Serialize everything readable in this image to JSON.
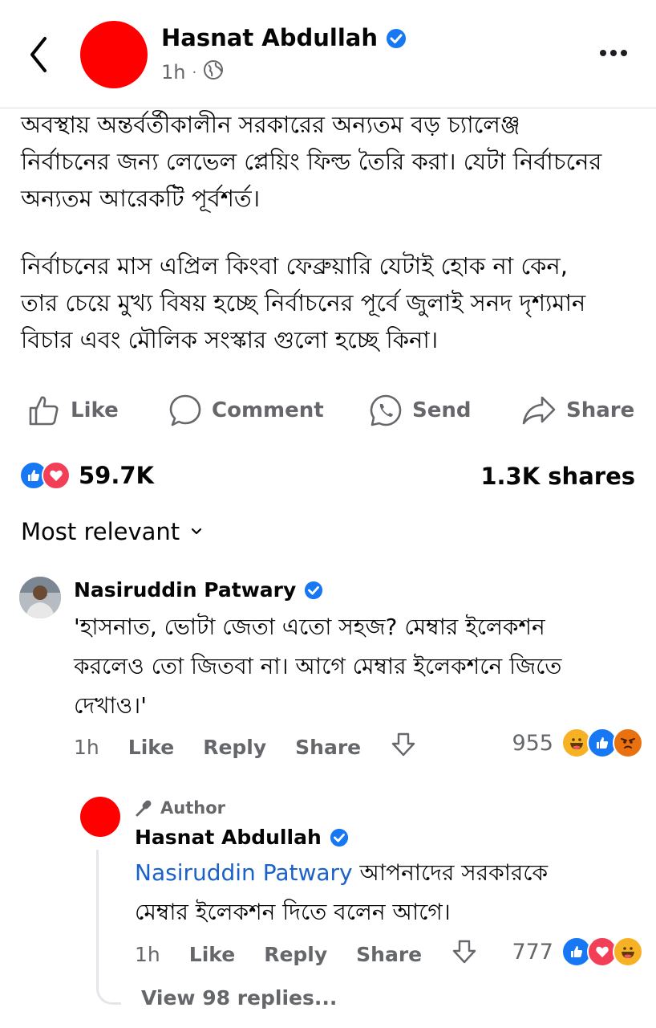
{
  "header": {
    "name": "Hasnat Abdullah",
    "time": "1h",
    "separator": "·"
  },
  "post": {
    "paragraph1": [
      "অবস্থায় অন্তর্বর্তীকালীন সরকারের অন্যতম বড় চ্যালেঞ্জ",
      "নির্বাচনের জন্য লেভেল প্লেয়িং ফিল্ড তৈরি করা। যেটা নির্বাচনের",
      "অন্যতম আরেকটি পূর্বশর্ত।"
    ],
    "paragraph2": [
      "নির্বাচনের মাস এপ্রিল কিংবা ফেব্রুয়ারি যেটাই হোক না কেন,",
      "তার চেয়ে মুখ্য বিষয় হচ্ছে নির্বাচনের পূর্বে জুলাই সনদ দৃশ্যমান",
      "বিচার এবং মৌলিক সংস্কার গুলো হচ্ছে কিনা।"
    ]
  },
  "actions": {
    "like": "Like",
    "comment": "Comment",
    "send": "Send",
    "share": "Share"
  },
  "stats": {
    "reactions_count": "59.7K",
    "shares": "1.3K shares"
  },
  "sort": {
    "label": "Most relevant"
  },
  "comment1": {
    "name": "Nasiruddin Patwary",
    "lines": [
      "'হাসনাত, ভোটা জেতা এতো সহজ? মেম্বার ইলেকশন",
      "করলেও তো জিতবা না। আগে মেম্বার ইলেকশনে জিতে",
      "দেখাও।'"
    ],
    "time": "1h",
    "like": "Like",
    "reply": "Reply",
    "share": "Share",
    "reaction_count": "955"
  },
  "reply1": {
    "author_label": "Author",
    "name": "Hasnat Abdullah",
    "mention": "Nasiruddin Patwary",
    "line1_rest": " আপনাদের সরকারকে",
    "line2": "মেম্বার ইলেকশন দিতে বলেন আগে।",
    "time": "1h",
    "like": "Like",
    "reply": "Reply",
    "share": "Share",
    "reaction_count": "777",
    "view_replies": "View 98 replies..."
  },
  "colors": {
    "accent_blue": "#1877f2",
    "mention_blue": "#1b62c8",
    "avatar_red": "#fe0000",
    "muted": "#65676b"
  }
}
